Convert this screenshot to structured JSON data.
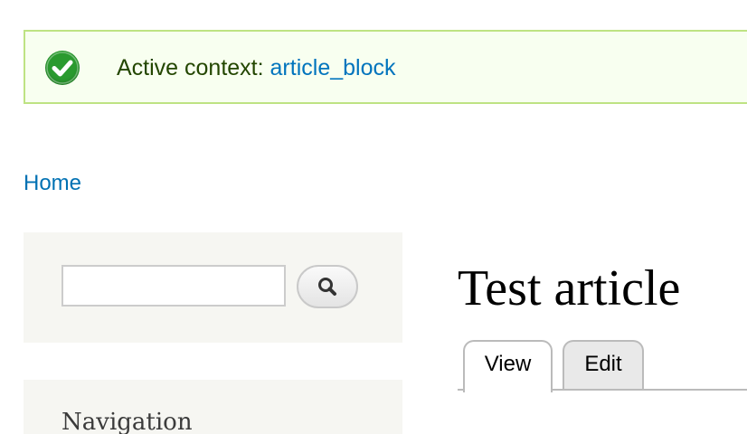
{
  "status": {
    "prefix": "Active context: ",
    "link_text": "article_block",
    "icon": "check-circle-icon",
    "colors": {
      "background": "#f8fff0",
      "border": "#bee383",
      "text": "#234600",
      "link": "#0074bd",
      "icon": "#2a9a2f"
    }
  },
  "breadcrumb": {
    "items": [
      {
        "label": "Home"
      }
    ]
  },
  "sidebar": {
    "search": {
      "value": "",
      "placeholder": "",
      "button_icon": "magnifier-icon"
    },
    "navigation": {
      "title": "Navigation"
    }
  },
  "main": {
    "title": "Test article",
    "tabs": [
      {
        "label": "View",
        "active": true
      },
      {
        "label": "Edit",
        "active": false
      }
    ]
  }
}
